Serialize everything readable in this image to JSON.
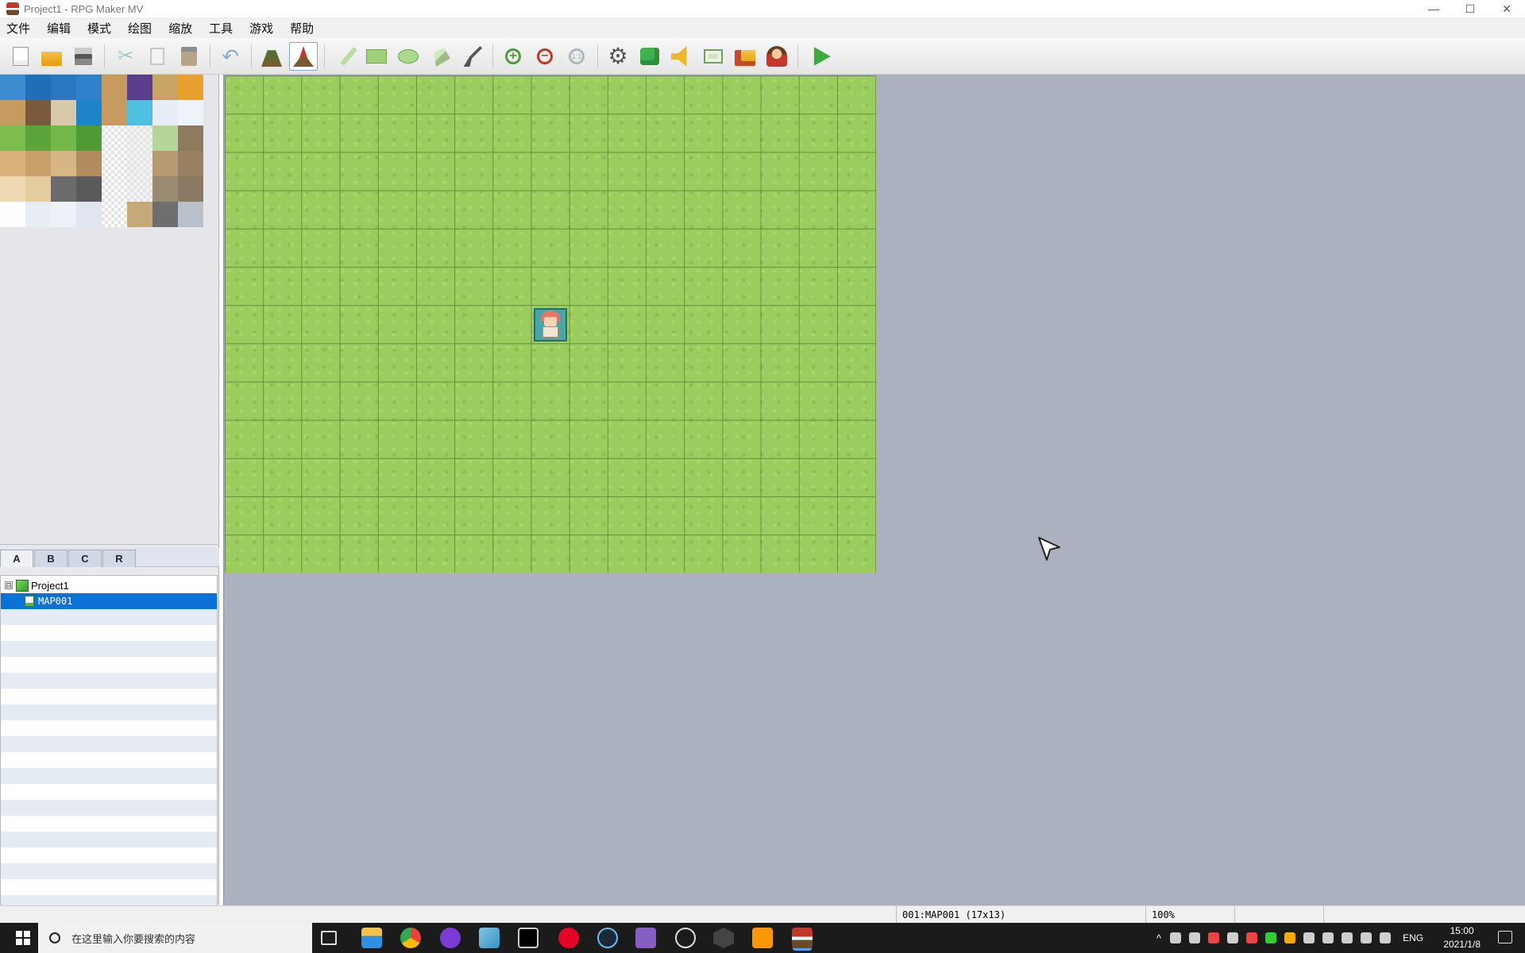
{
  "window": {
    "title": "Project1 - RPG Maker MV",
    "controls": [
      "—",
      "☐",
      "✕"
    ]
  },
  "menu": [
    "文件",
    "编辑",
    "模式",
    "绘图",
    "缩放",
    "工具",
    "游戏",
    "帮助"
  ],
  "toolbar": {
    "buttons": [
      "new-project",
      "open-project",
      "save-project",
      "cut",
      "copy",
      "paste",
      "undo",
      "map-mode",
      "event-mode",
      "pencil",
      "rectangle",
      "ellipse",
      "flood-fill",
      "shadow-pen",
      "zoom-in",
      "zoom-out",
      "actual-size",
      "database",
      "plugin-manager",
      "sound-test",
      "event-searcher",
      "resource-manager",
      "character-generator",
      "playtest"
    ],
    "active": "event-mode"
  },
  "tileset_tabs": [
    "A",
    "B",
    "C",
    "R"
  ],
  "active_tab": "A",
  "map_tree": [
    {
      "label": "Project1",
      "type": "project",
      "expander": "⊟"
    },
    {
      "label": "MAP001",
      "type": "map",
      "selected": true
    }
  ],
  "map": {
    "width_tiles": 17,
    "height_tiles": 13,
    "tile_color": "#9ccc5e",
    "event_tile": [
      8,
      6
    ]
  },
  "status": {
    "map_info": "001:MAP001 (17x13)",
    "zoom": "100%"
  },
  "taskbar": {
    "search_placeholder": "在这里输入你要搜索的内容",
    "apps": [
      "task-view",
      "file-explorer",
      "chrome",
      "app-purple",
      "app-notes",
      "terminal",
      "netease-music",
      "steam",
      "visual-studio",
      "app-disc",
      "unity",
      "sublime-text",
      "rpg-maker"
    ],
    "lang": "ENG",
    "time": "15:00",
    "date": "2021/1/8"
  },
  "colors": {
    "accent": "#0a72d8",
    "map_bg": "#abb1bf",
    "grass": "#9ccc5e"
  }
}
